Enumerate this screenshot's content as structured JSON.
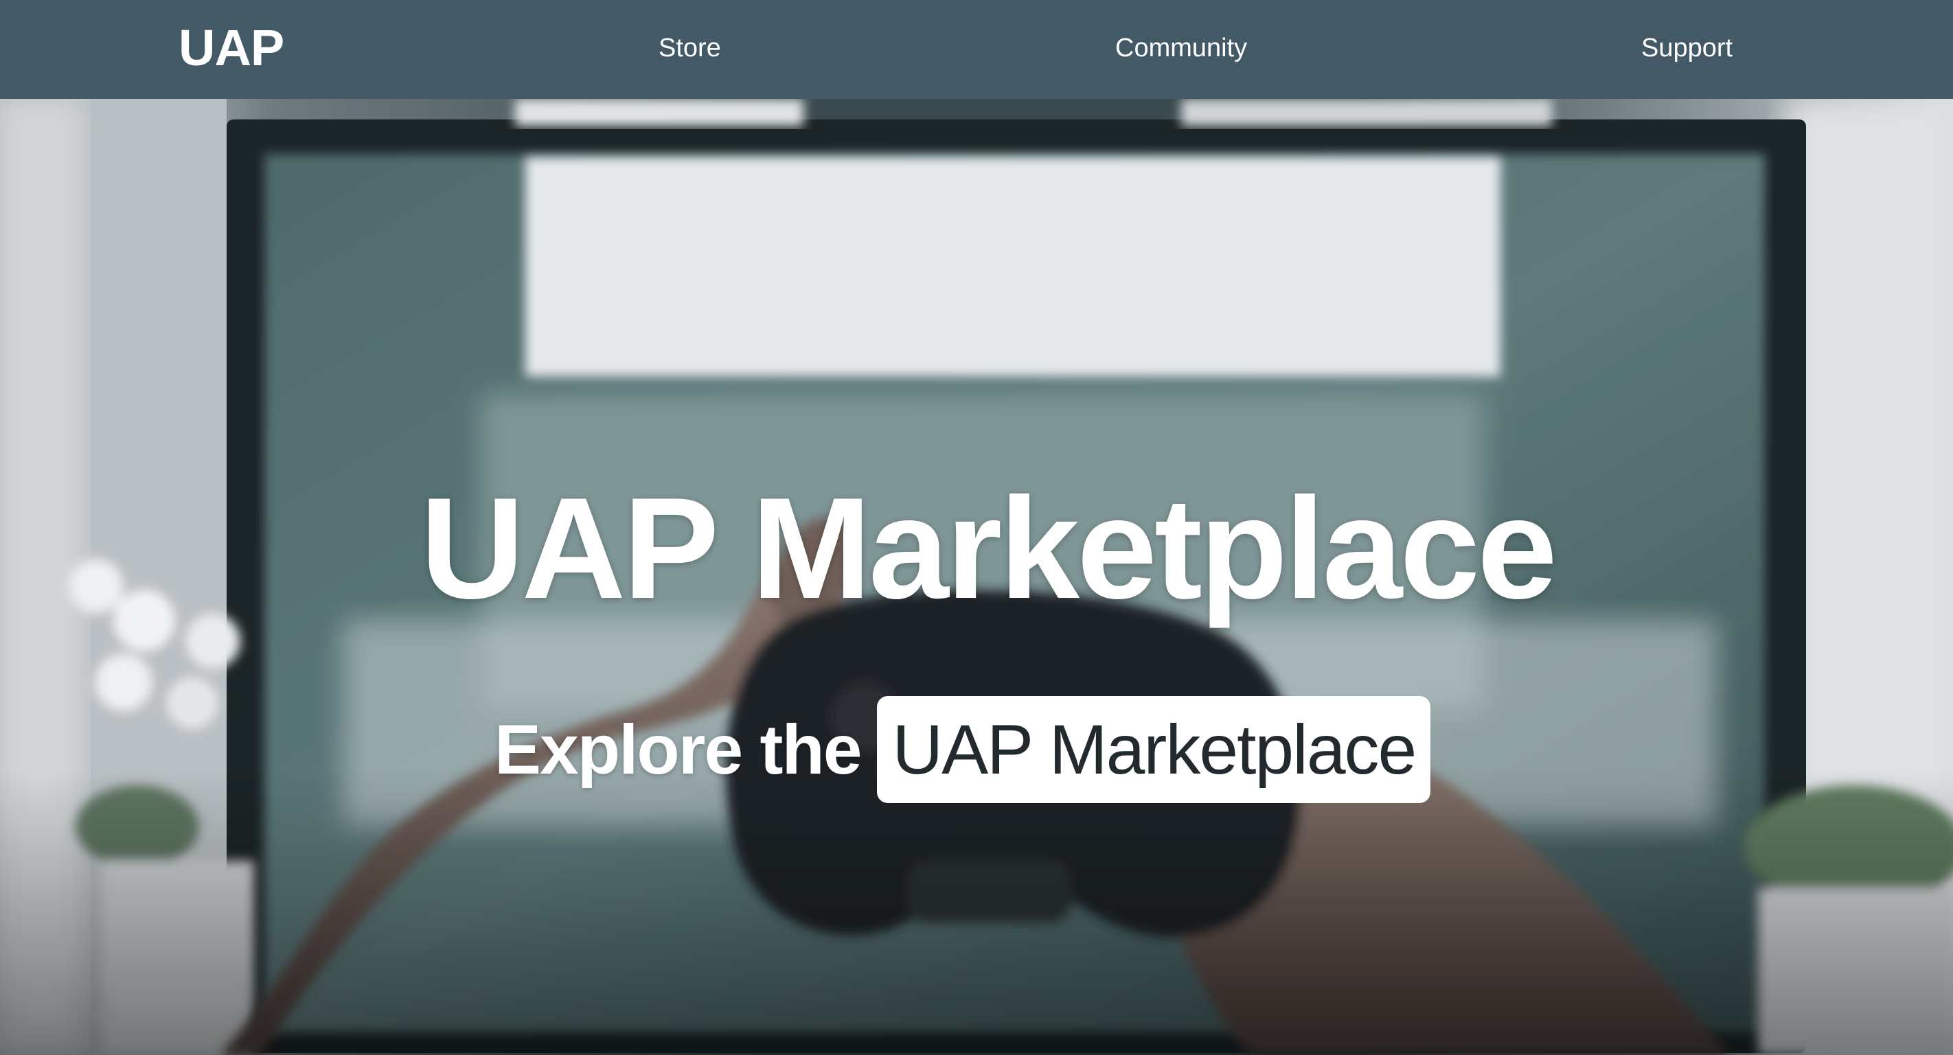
{
  "nav": {
    "logo": "UAP",
    "links": [
      {
        "label": "Store"
      },
      {
        "label": "Community"
      },
      {
        "label": "Support"
      }
    ]
  },
  "hero": {
    "title": "UAP Marketplace",
    "subtitle_lead": "Explore the",
    "subtitle_highlight": "UAP Marketplace",
    "background": "photo of hands holding a game controller in front of a TV"
  },
  "colors": {
    "navbar": "#435a66",
    "highlight_bg": "#ffffff",
    "highlight_text": "#222a2d"
  }
}
